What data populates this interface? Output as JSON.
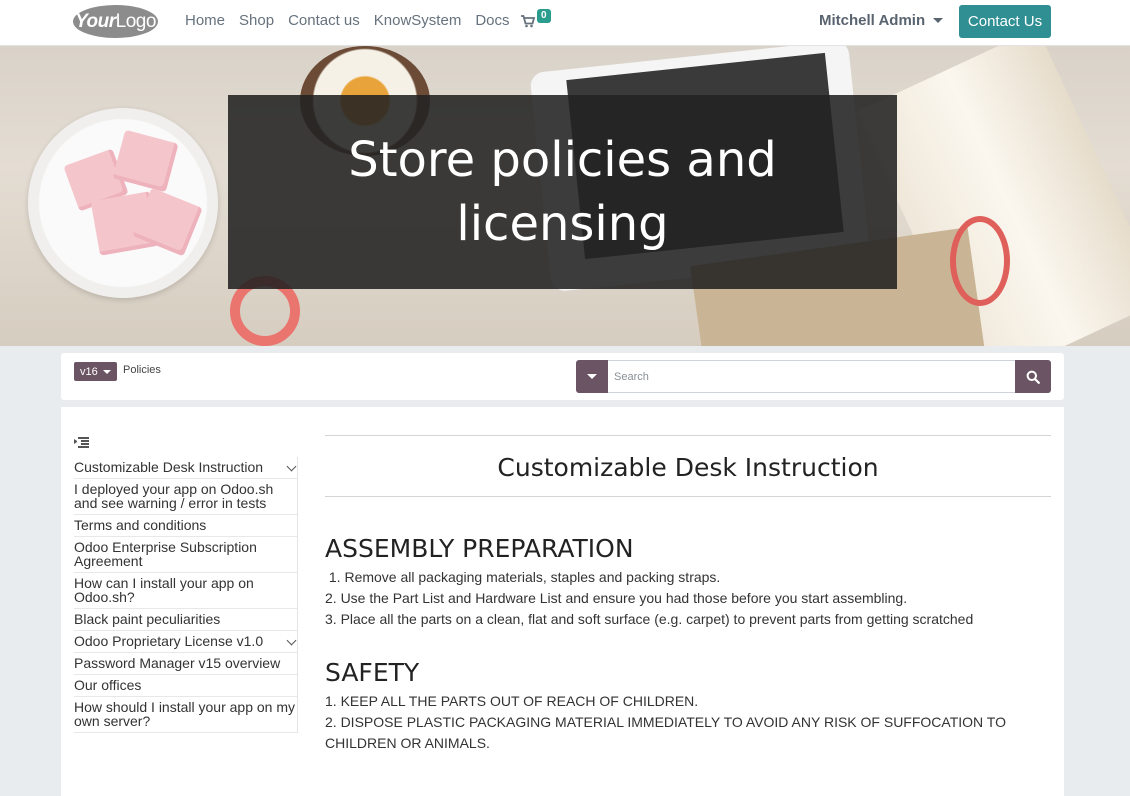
{
  "nav": {
    "logo_bold": "Your",
    "logo_thin": "Logo",
    "links": [
      "Home",
      "Shop",
      "Contact us",
      "KnowSystem",
      "Docs"
    ],
    "cart_count": "0",
    "user": "Mitchell Admin",
    "contact_button": "Contact Us"
  },
  "hero": {
    "title": "Store policies and licensing"
  },
  "toolbar": {
    "version": "v16",
    "breadcrumb": "Policies",
    "search_placeholder": "Search"
  },
  "sidebar": {
    "items": [
      {
        "label": "Customizable Desk Instruction",
        "expandable": true
      },
      {
        "label": "I deployed your app on Odoo.sh and see warning / error in tests",
        "expandable": false
      },
      {
        "label": "Terms and conditions",
        "expandable": false
      },
      {
        "label": "Odoo Enterprise Subscription Agreement",
        "expandable": false
      },
      {
        "label": "How can I install your app on Odoo.sh?",
        "expandable": false
      },
      {
        "label": "Black paint peculiarities",
        "expandable": false
      },
      {
        "label": "Odoo Proprietary License v1.0",
        "expandable": true
      },
      {
        "label": "Password Manager v15 overview",
        "expandable": false
      },
      {
        "label": "Our offices",
        "expandable": false
      },
      {
        "label": "How should I install your app on my own server?",
        "expandable": false
      }
    ]
  },
  "article": {
    "title": "Customizable Desk Instruction",
    "sections": [
      {
        "heading": "ASSEMBLY PREPARATION",
        "lines": [
          " 1. Remove all packaging materials, staples and packing straps.",
          "2. Use the Part List and Hardware List and ensure you had those before you start assembling.",
          "3. Place all the parts on a clean, flat and soft surface (e.g. carpet) to prevent parts from getting scratched"
        ]
      },
      {
        "heading": "SAFETY",
        "lines": [
          "1. KEEP ALL THE PARTS OUT OF REACH OF CHILDREN.",
          "2. DISPOSE PLASTIC PACKAGING MATERIAL IMMEDIATELY TO AVOID ANY RISK OF SUFFOCATION TO CHILDREN OR ANIMALS."
        ]
      }
    ]
  },
  "colors": {
    "accent": "#2f8f93",
    "secondary": "#6b5564"
  }
}
